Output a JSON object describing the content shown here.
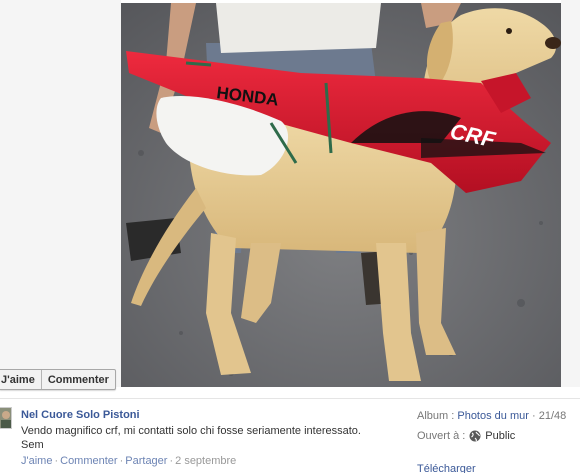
{
  "photo": {
    "fairing_text": "HONDA",
    "number_plate_text": "CRF"
  },
  "actions_pill": {
    "like_label": "J'aime",
    "comment_label": "Commenter"
  },
  "post": {
    "author": "Nel Cuore Solo Pistoni",
    "caption": "Vendo magnifico crf, mi contatti solo chi fosse seriamente interessato. Sem",
    "like_link": "J'aime",
    "comment_link": "Commenter",
    "share_link": "Partager",
    "date": "2 septembre"
  },
  "meta": {
    "album_label": "Album :",
    "album_name": "Photos du mur",
    "album_position": "21/48",
    "privacy_label": "Ouvert à :",
    "privacy_value": "Public",
    "download_label": "Télécharger"
  },
  "colors": {
    "link_blue": "#3b5998",
    "action_blue": "#6d84b4",
    "fairing_red": "#d9142c"
  }
}
